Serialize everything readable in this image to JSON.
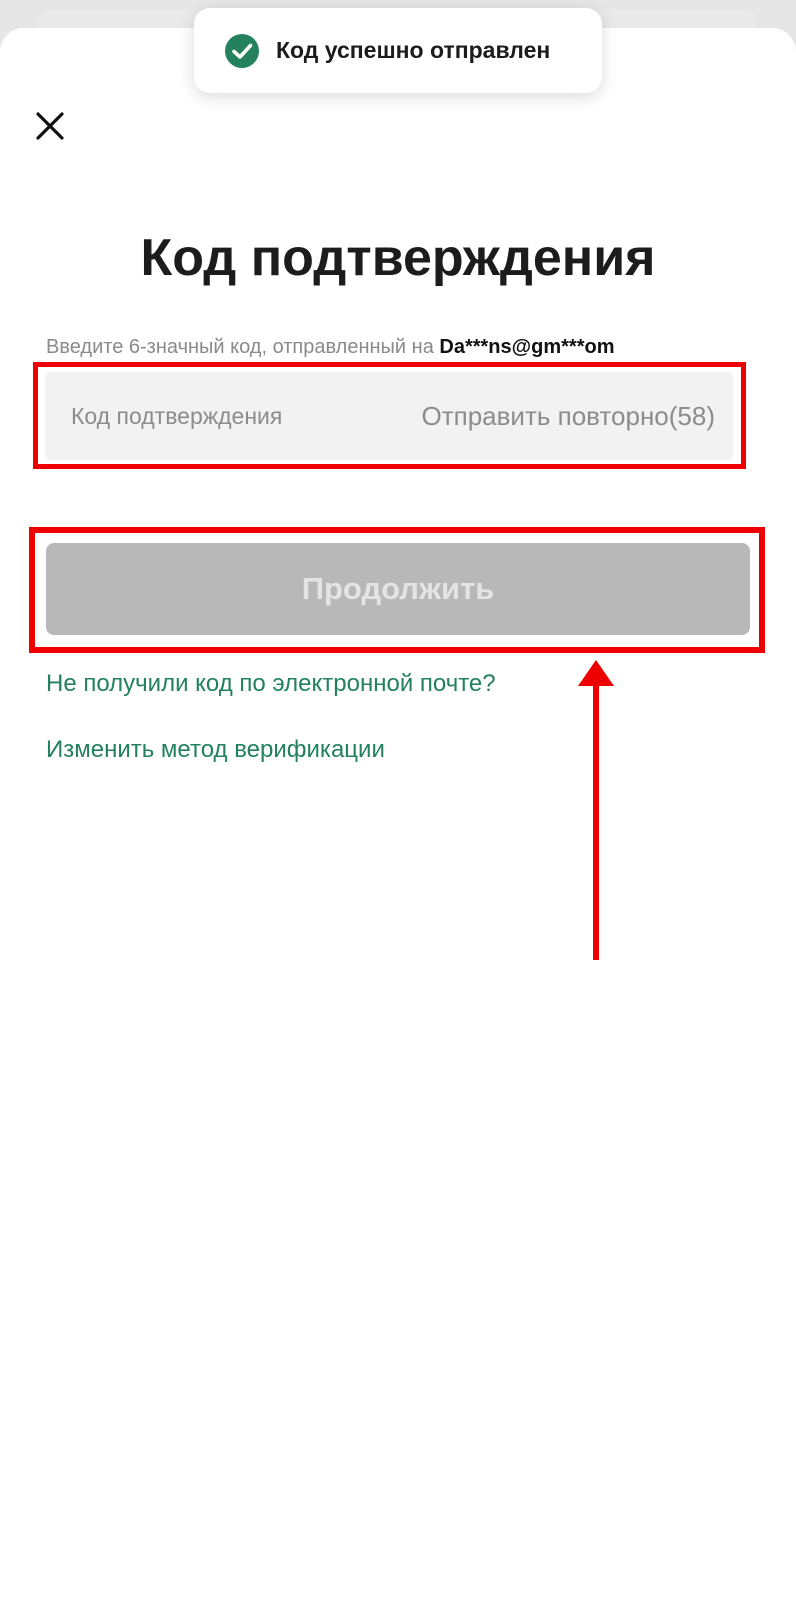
{
  "toast": {
    "icon": "check-circle-icon",
    "icon_color": "#23825d",
    "message": "Код успешно отправлен"
  },
  "close_icon": "close-icon",
  "title": "Код подтверждения",
  "hint": {
    "text": "Введите 6-значный код, отправленный на ",
    "email": "Da***ns@gm***om"
  },
  "code_field": {
    "placeholder": "Код подтверждения",
    "value": "",
    "resend_label": "Отправить повторно(58)"
  },
  "continue_button": {
    "label": "Продолжить",
    "enabled": false
  },
  "links": {
    "no_code": "Не получили код по электронной почте?",
    "change_method": "Изменить метод верификации"
  },
  "colors": {
    "accent": "#23825d",
    "annotation": "#ee0000",
    "button_disabled": "#b8b8b8"
  },
  "annotations": {
    "highlight_boxes": 2,
    "arrow_direction": "up"
  }
}
